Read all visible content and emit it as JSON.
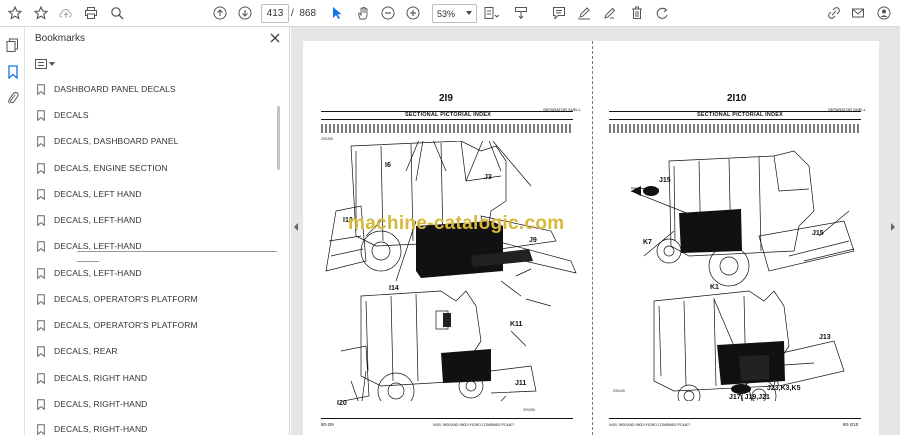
{
  "toolbar": {
    "current_page": "413",
    "page_separator": "/",
    "total_pages": "868",
    "zoom": "53%"
  },
  "bookmarks_panel": {
    "title": "Bookmarks",
    "items": [
      {
        "label": "DASHBOARD PANEL DECALS"
      },
      {
        "label": "DECALS"
      },
      {
        "label": "DECALS, DASHBOARD PANEL"
      },
      {
        "label": "DECALS, ENGINE SECTION"
      },
      {
        "label": "DECALS, LEFT HAND"
      },
      {
        "label": "DECALS, LEFT-HAND"
      },
      {
        "label": "DECALS, LEFT-HAND"
      },
      {
        "label": "DECALS, LEFT-HAND"
      },
      {
        "label": "DECALS, OPERATOR'S PLATFORM"
      },
      {
        "label": "DECALS, OPERATOR'S PLATFORM"
      },
      {
        "label": "DECALS, REAR"
      },
      {
        "label": "DECALS, RIGHT HAND"
      },
      {
        "label": "DECALS, RIGHT-HAND"
      },
      {
        "label": "DECALS, RIGHT-HAND"
      }
    ]
  },
  "document": {
    "left_page": {
      "page_number": "2I9",
      "section": "SEPARATOR SHELL",
      "title": "SECTIONAL PICTORIAL INDEX",
      "callouts": [
        "I6",
        "J3",
        "I12",
        "J9",
        "I8",
        "I14",
        "K11",
        "J11",
        "I20"
      ],
      "figure_ids": [
        "Z90455",
        "Z90456"
      ],
      "footer_left": "80-2I9"
    },
    "right_page": {
      "page_number": "2I10",
      "section": "SEPARATOR SHELL",
      "title": "SECTIONAL PICTORIAL INDEX",
      "callouts": [
        "J15",
        "J15",
        "K7",
        "K1",
        "J13",
        "J23,K3,K5",
        "J17, J19,J21"
      ],
      "figure_ids": [
        "Z90445"
      ],
      "footer_right": "80-2I10"
    },
    "footer_center": "9400, 9500 AND 9500 HYDRO COMBINES  PC4407"
  },
  "watermark": "machine-catalogic.com",
  "colors": {
    "accent_blue": "#1473e6",
    "watermark": "#d6b83a",
    "viewer_bg": "#e6e6e6"
  }
}
